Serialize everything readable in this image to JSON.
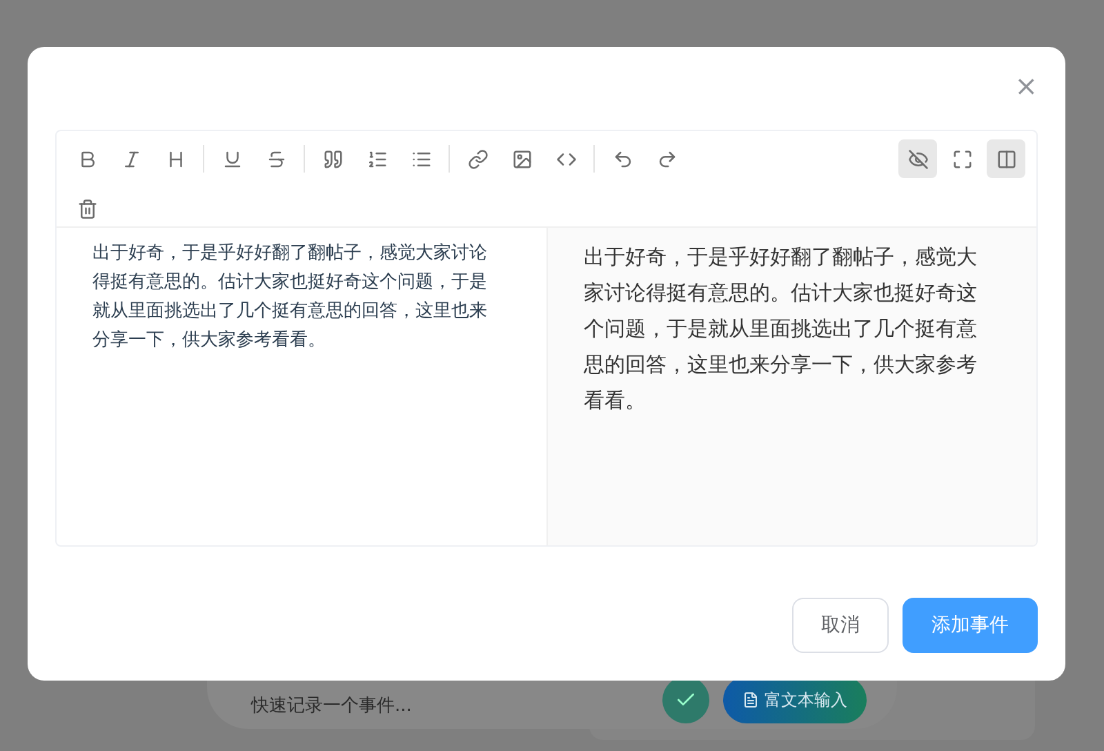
{
  "background": {
    "quick_input": {
      "placeholder": "快速记录一个事件..."
    },
    "rich_text_button": {
      "label": "富文本输入"
    }
  },
  "dialog": {
    "close": "×",
    "toolbar": {
      "left": [
        {
          "kind": "bold"
        },
        {
          "kind": "italic"
        },
        {
          "kind": "heading"
        },
        {
          "kind": "divider"
        },
        {
          "kind": "underline"
        },
        {
          "kind": "strike"
        },
        {
          "kind": "divider"
        },
        {
          "kind": "quote"
        },
        {
          "kind": "ordered-list"
        },
        {
          "kind": "bullet-list"
        },
        {
          "kind": "divider"
        },
        {
          "kind": "link"
        },
        {
          "kind": "image"
        },
        {
          "kind": "code"
        },
        {
          "kind": "divider"
        },
        {
          "kind": "undo"
        },
        {
          "kind": "redo"
        }
      ],
      "right": [
        {
          "kind": "preview",
          "selected": true
        },
        {
          "kind": "fullscreen",
          "selected": false
        },
        {
          "kind": "split",
          "selected": true
        }
      ],
      "second_row": [
        {
          "kind": "trash"
        }
      ]
    },
    "editor_text": "出于好奇，于是乎好好翻了翻帖子，感觉大家讨论得挺有意思的。估计大家也挺好奇这个问题，于是就从里面挑选出了几个挺有意思的回答，这里也来分享一下，供大家参考看看。",
    "preview_text": "出于好奇，于是乎好好翻了翻帖子，感觉大家讨论得挺有意思的。估计大家也挺好奇这个问题，于是就从里面挑选出了几个挺有意思的回答，这里也来分享一下，供大家参考看看。",
    "buttons": [
      {
        "label": "取消",
        "kind": "secondary"
      },
      {
        "label": "添加事件",
        "kind": "primary"
      }
    ]
  }
}
